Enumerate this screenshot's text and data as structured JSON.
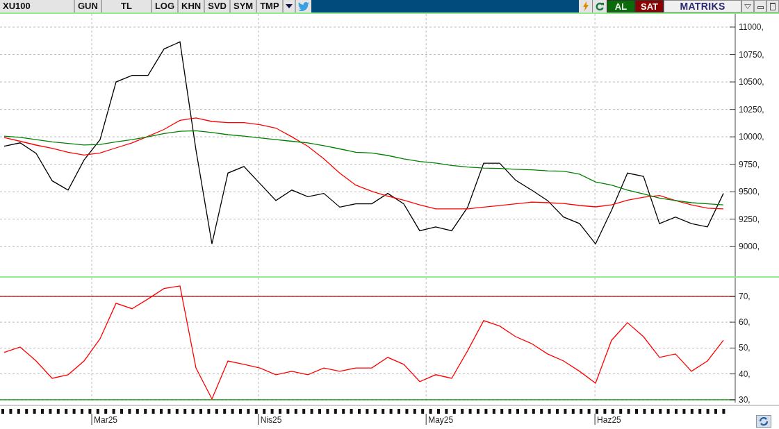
{
  "toolbar": {
    "symbol": "XU100",
    "buttons": [
      "GUN",
      "TL",
      "LOG",
      "KHN",
      "SVD",
      "SYM",
      "TMP"
    ],
    "actions": [
      {
        "label": "AL",
        "kind": "buy"
      },
      {
        "label": "SAT",
        "kind": "sell"
      }
    ],
    "brand": "MATRIKS"
  },
  "price_chart": {
    "chart_data": {
      "type": "line",
      "grid": true,
      "series": [
        {
          "color": "#000000",
          "values": [
            9914,
            9945,
            9850,
            9600,
            9515,
            9790,
            9975,
            10500,
            10560,
            10560,
            10800,
            10865,
            9880,
            9025,
            9670,
            9730,
            9575,
            9420,
            9515,
            9455,
            9485,
            9360,
            9390,
            9390,
            9485,
            9390,
            9145,
            9180,
            9145,
            9360,
            9760,
            9760,
            9605,
            9515,
            9420,
            9270,
            9210,
            9025,
            9330,
            9670,
            9640,
            9210,
            9270,
            9210,
            9180,
            9485
          ]
        },
        {
          "color": "#ff0000",
          "values": [
            9994,
            9960,
            9925,
            9896,
            9860,
            9834,
            9853,
            9900,
            9945,
            10005,
            10067,
            10150,
            10172,
            10140,
            10129,
            10129,
            10110,
            10080,
            10000,
            9914,
            9800,
            9669,
            9560,
            9503,
            9460,
            9423,
            9380,
            9344,
            9344,
            9344,
            9360,
            9374,
            9390,
            9405,
            9400,
            9393,
            9375,
            9362,
            9380,
            9423,
            9450,
            9466,
            9420,
            9380,
            9350,
            9344
          ]
        },
        {
          "color": "#008000",
          "values": [
            10006,
            9995,
            9975,
            9955,
            9940,
            9926,
            9930,
            9955,
            9975,
            10000,
            10030,
            10050,
            10055,
            10040,
            10020,
            10006,
            9990,
            9975,
            9960,
            9945,
            9920,
            9890,
            9860,
            9853,
            9830,
            9800,
            9775,
            9761,
            9740,
            9725,
            9715,
            9712,
            9705,
            9700,
            9690,
            9687,
            9660,
            9589,
            9560,
            9515,
            9480,
            9442,
            9420,
            9400,
            9390,
            9380
          ]
        }
      ],
      "ylim": [
        8730,
        11120
      ],
      "yticks": [
        {
          "value": 9000,
          "label": "9000,"
        },
        {
          "value": 9250,
          "label": "9250,"
        },
        {
          "value": 9500,
          "label": "9500,"
        },
        {
          "value": 9750,
          "label": "9750,"
        },
        {
          "value": 10000,
          "label": "10000,"
        },
        {
          "value": 10250,
          "label": "10250,"
        },
        {
          "value": 10500,
          "label": "10500,"
        },
        {
          "value": 10750,
          "label": "10750,"
        },
        {
          "value": 11000,
          "label": "11000,"
        }
      ]
    }
  },
  "rsi_chart": {
    "chart_data": {
      "type": "line",
      "grid": true,
      "series": [
        {
          "color": "#ff0000",
          "values": [
            48.3,
            50.4,
            45,
            38.3,
            39.7,
            45,
            53.6,
            67.3,
            65.2,
            69,
            73,
            74,
            42.3,
            30.3,
            45,
            43.7,
            42.3,
            39.7,
            41,
            39.7,
            42.3,
            41,
            42.3,
            42.3,
            46.4,
            43.7,
            37,
            39.7,
            38.3,
            49,
            60.6,
            58.5,
            54.4,
            51.7,
            47.7,
            45,
            41,
            36.4,
            53,
            59.8,
            54.4,
            46.4,
            47.7,
            41,
            45,
            53
          ]
        }
      ],
      "ylim": [
        28.9,
        77.2
      ],
      "yticks": [
        {
          "value": 30,
          "label": "30,"
        },
        {
          "value": 40,
          "label": "40,"
        },
        {
          "value": 50,
          "label": "50,"
        },
        {
          "value": 60,
          "label": "60,"
        },
        {
          "value": 70,
          "label": "70,"
        }
      ],
      "ref_lines": [
        {
          "axis": "y",
          "value": 70,
          "color": "#990000"
        },
        {
          "axis": "y",
          "value": 30,
          "color": "#009900"
        }
      ]
    }
  },
  "date_axis": {
    "labels": [
      "Mar25",
      "Nis25",
      "May25",
      "Haz25"
    ]
  }
}
